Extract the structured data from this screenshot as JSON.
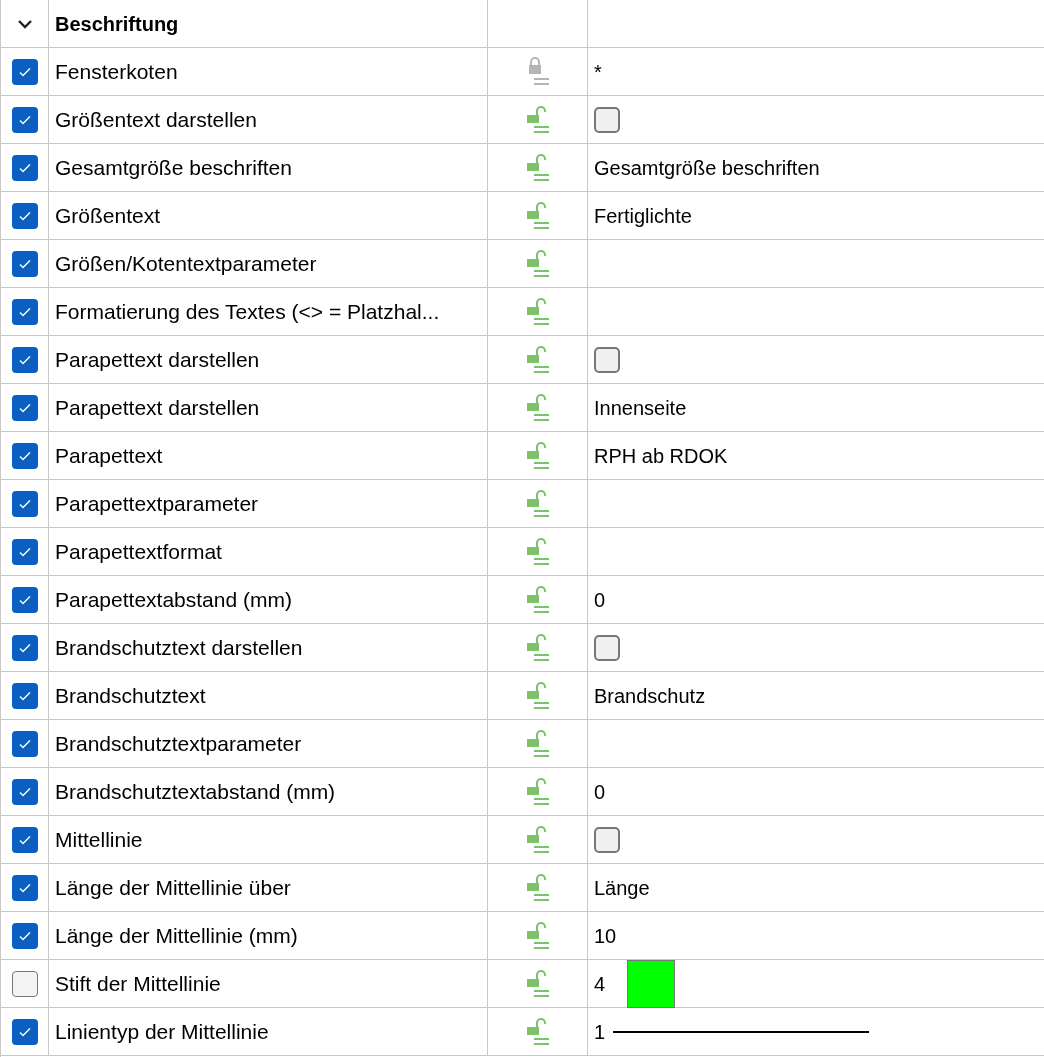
{
  "group": {
    "title": "Beschriftung",
    "expanded": true
  },
  "rows": [
    {
      "checked": true,
      "label": "Fensterkoten",
      "locked": true,
      "kind": "text",
      "value": "*"
    },
    {
      "checked": true,
      "label": "Größentext darstellen",
      "locked": false,
      "kind": "checkbox",
      "value_checked": false
    },
    {
      "checked": true,
      "label": "Gesamtgröße beschriften",
      "locked": false,
      "kind": "text",
      "value": "Gesamtgröße beschriften"
    },
    {
      "checked": true,
      "label": "Größentext",
      "locked": false,
      "kind": "text",
      "value": "Fertiglichte"
    },
    {
      "checked": true,
      "label": "Größen/Kotentextparameter",
      "locked": false,
      "kind": "empty"
    },
    {
      "checked": true,
      "label": "Formatierung des Textes (<> = Platzhal...",
      "locked": false,
      "kind": "empty"
    },
    {
      "checked": true,
      "label": "Parapettext darstellen",
      "locked": false,
      "kind": "checkbox",
      "value_checked": false
    },
    {
      "checked": true,
      "label": "Parapettext darstellen",
      "locked": false,
      "kind": "text",
      "value": "Innenseite"
    },
    {
      "checked": true,
      "label": "Parapettext",
      "locked": false,
      "kind": "text",
      "value": "RPH ab RDOK"
    },
    {
      "checked": true,
      "label": "Parapettextparameter",
      "locked": false,
      "kind": "empty"
    },
    {
      "checked": true,
      "label": "Parapettextformat",
      "locked": false,
      "kind": "empty"
    },
    {
      "checked": true,
      "label": "Parapettextabstand (mm)",
      "locked": false,
      "kind": "text",
      "value": "0"
    },
    {
      "checked": true,
      "label": "Brandschutztext darstellen",
      "locked": false,
      "kind": "checkbox",
      "value_checked": false
    },
    {
      "checked": true,
      "label": "Brandschutztext",
      "locked": false,
      "kind": "text",
      "value": "Brandschutz"
    },
    {
      "checked": true,
      "label": "Brandschutztextparameter",
      "locked": false,
      "kind": "empty"
    },
    {
      "checked": true,
      "label": "Brandschutztextabstand (mm)",
      "locked": false,
      "kind": "text",
      "value": "0"
    },
    {
      "checked": true,
      "label": "Mittellinie",
      "locked": false,
      "kind": "checkbox",
      "value_checked": false
    },
    {
      "checked": true,
      "label": "Länge der Mittellinie über",
      "locked": false,
      "kind": "text",
      "value": "Länge"
    },
    {
      "checked": true,
      "label": "Länge der Mittellinie (mm)",
      "locked": false,
      "kind": "text",
      "value": "10"
    },
    {
      "checked": false,
      "label": "Stift der Mittellinie",
      "locked": false,
      "kind": "pen",
      "value": "4",
      "color": "#00ff00"
    },
    {
      "checked": true,
      "label": "Linientyp der Mittellinie",
      "locked": false,
      "kind": "linetype",
      "value": "1"
    }
  ]
}
